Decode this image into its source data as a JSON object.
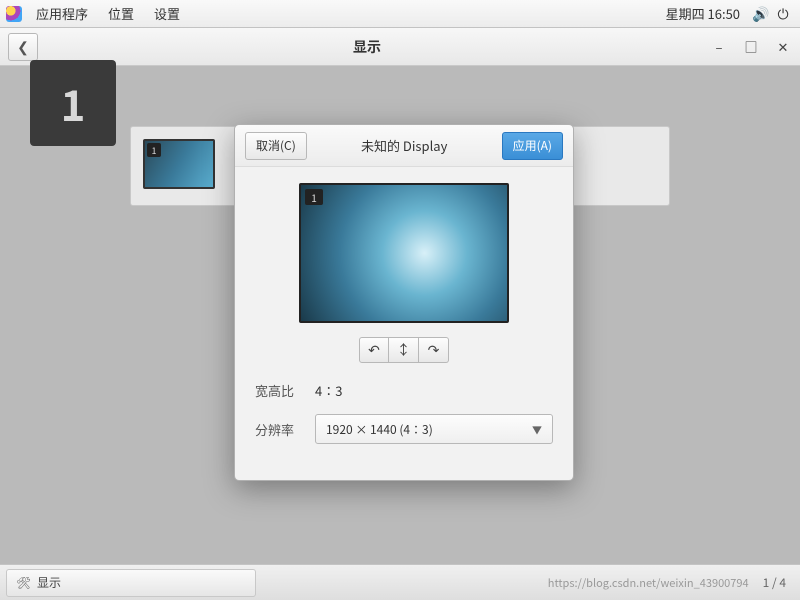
{
  "menubar": {
    "items": [
      "应用程序",
      "位置",
      "设置"
    ],
    "clock": "星期四 16:50"
  },
  "window": {
    "title": "显示"
  },
  "overlay_number": "1",
  "thumb_number": "1",
  "dialog": {
    "cancel": "取消(C)",
    "title": "未知的  Display",
    "apply": "应用(A)",
    "preview_number": "1",
    "aspect_label": "宽高比",
    "aspect_value": "4∶3",
    "resolution_label": "分辨率",
    "resolution_value": "1920 × 1440 (4∶3)"
  },
  "taskbar": {
    "app": "显示",
    "watermark": "https://blog.csdn.net/weixin_43900794",
    "pager": "1 / 4"
  }
}
